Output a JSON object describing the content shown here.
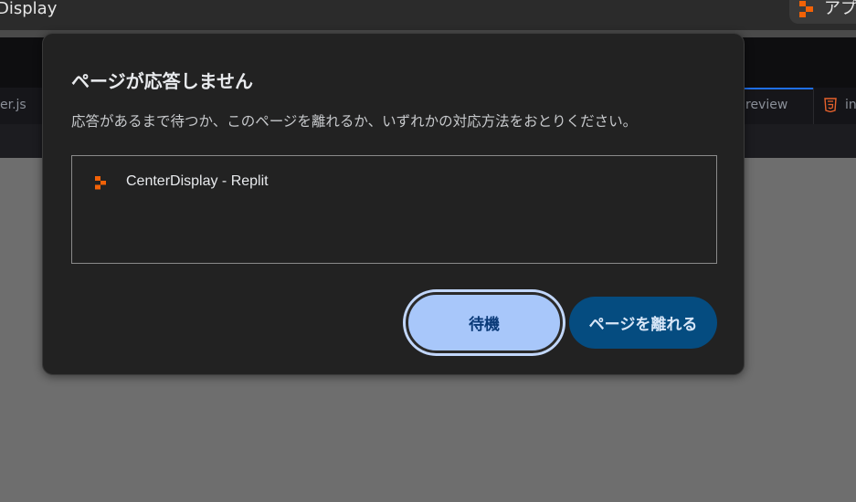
{
  "window": {
    "title": "Display",
    "apps_label": "アプリ"
  },
  "editor": {
    "tab_left": "er.js",
    "tab_right": "review",
    "tab_ind": "ind"
  },
  "dialog": {
    "heading": "ページが応答しません",
    "message": "応答があるまで待つか、このページを離れるか、いずれかの対応方法をおとりください。",
    "pages": [
      {
        "title": "CenterDisplay - Replit",
        "icon": "replit-icon"
      }
    ],
    "wait_button": "待機",
    "leave_button": "ページを離れる"
  },
  "colors": {
    "replit_orange": "#f26207",
    "wait_bg": "#a8c7fa",
    "leave_bg": "#054c80"
  }
}
